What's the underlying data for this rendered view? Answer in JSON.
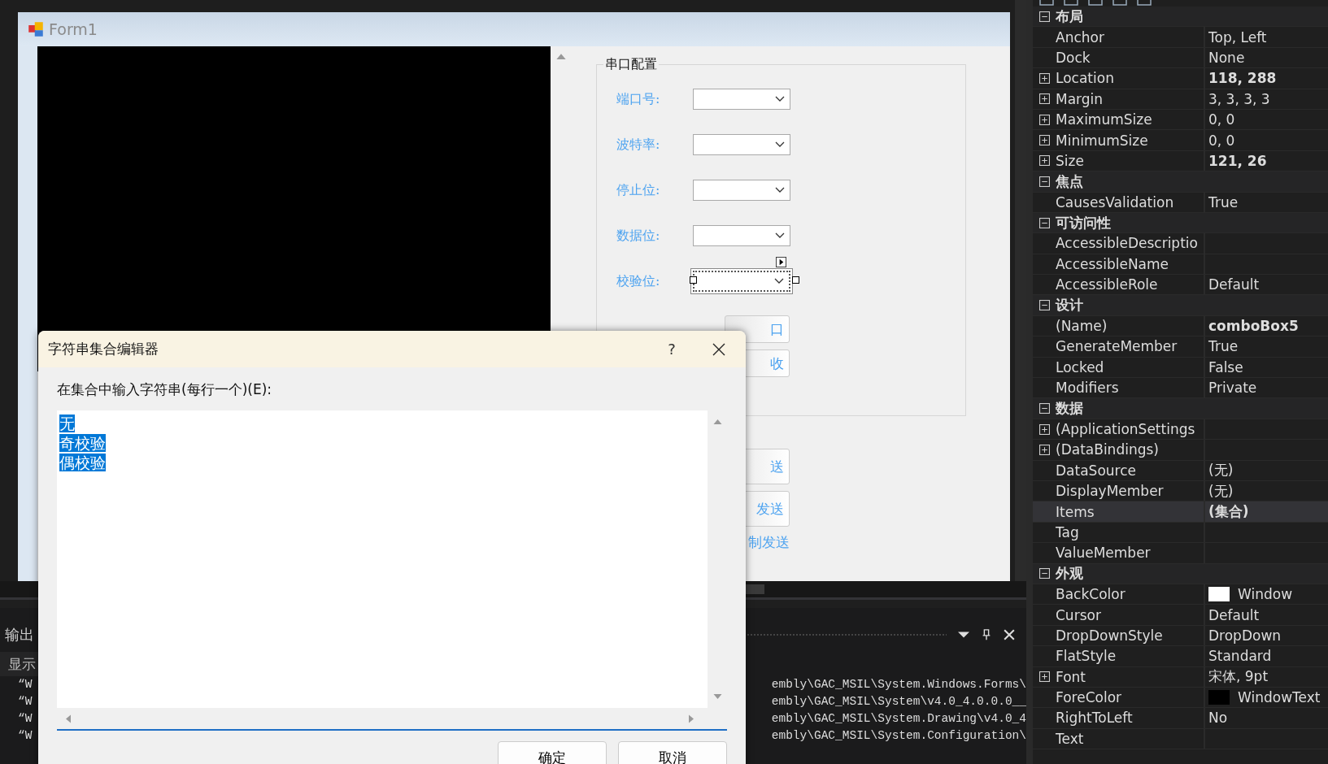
{
  "form": {
    "title": "Form1",
    "group": {
      "title": "串口配置",
      "fields": [
        {
          "label": "端口号:",
          "selected": false
        },
        {
          "label": "波特率:",
          "selected": false
        },
        {
          "label": "停止位:",
          "selected": false
        },
        {
          "label": "数据位:",
          "selected": false
        },
        {
          "label": "校验位:",
          "selected": true
        }
      ]
    },
    "group_buttons": [
      "口",
      "收"
    ],
    "lower_buttons": [
      "送",
      "发送"
    ],
    "lower_label": "制发送"
  },
  "dialog": {
    "title": "字符串集合编辑器",
    "help": "?",
    "prompt": "在集合中输入字符串(每行一个)(E):",
    "lines": [
      "无",
      "奇校验",
      "偶校验"
    ],
    "lines_selected": true,
    "buttons": [
      "确定",
      "取消"
    ]
  },
  "output": {
    "title": "输出",
    "show_label": "显示",
    "lines": [
      {
        "start": "“W",
        "end": "embly\\GAC_MSIL\\System.Windows.Forms\\"
      },
      {
        "start": "“W",
        "end": "embly\\GAC_MSIL\\System\\v4.0_4.0.0.0__"
      },
      {
        "start": "“W",
        "end": "embly\\GAC_MSIL\\System.Drawing\\v4.0_4"
      },
      {
        "start": "“W",
        "end": "embly\\GAC_MSIL\\System.Configuration\\"
      }
    ]
  },
  "properties": {
    "categories": [
      {
        "name": "布局",
        "expanded": true,
        "props": [
          {
            "name": "Anchor",
            "value": "Top, Left",
            "expandable": false,
            "bold": false,
            "selected": false
          },
          {
            "name": "Dock",
            "value": "None",
            "expandable": false,
            "bold": false,
            "selected": false
          },
          {
            "name": "Location",
            "value": "118, 288",
            "expandable": true,
            "bold": true,
            "selected": false
          },
          {
            "name": "Margin",
            "value": "3, 3, 3, 3",
            "expandable": true,
            "bold": false,
            "selected": false
          },
          {
            "name": "MaximumSize",
            "value": "0, 0",
            "expandable": true,
            "bold": false,
            "selected": false
          },
          {
            "name": "MinimumSize",
            "value": "0, 0",
            "expandable": true,
            "bold": false,
            "selected": false
          },
          {
            "name": "Size",
            "value": "121, 26",
            "expandable": true,
            "bold": true,
            "selected": false
          }
        ]
      },
      {
        "name": "焦点",
        "expanded": true,
        "props": [
          {
            "name": "CausesValidation",
            "value": "True",
            "expandable": false,
            "bold": false,
            "selected": false
          }
        ]
      },
      {
        "name": "可访问性",
        "expanded": true,
        "props": [
          {
            "name": "AccessibleDescriptio",
            "expandable": false,
            "selected": false
          },
          {
            "name": "AccessibleName",
            "expandable": false,
            "selected": false
          },
          {
            "name": "AccessibleRole",
            "value": "Default",
            "expandable": false,
            "bold": false,
            "selected": false
          }
        ]
      },
      {
        "name": "设计",
        "expanded": true,
        "props": [
          {
            "name": "(Name)",
            "value": "comboBox5",
            "expandable": false,
            "bold": true,
            "selected": false
          },
          {
            "name": "GenerateMember",
            "value": "True",
            "expandable": false,
            "bold": false,
            "selected": false
          },
          {
            "name": "Locked",
            "value": "False",
            "expandable": false,
            "bold": false,
            "selected": false
          },
          {
            "name": "Modifiers",
            "value": "Private",
            "expandable": false,
            "bold": false,
            "selected": false
          }
        ]
      },
      {
        "name": "数据",
        "expanded": true,
        "props": [
          {
            "name": "(ApplicationSettings",
            "expandable": true,
            "selected": false
          },
          {
            "name": "(DataBindings)",
            "expandable": true,
            "selected": false
          },
          {
            "name": "DataSource",
            "value": "(无)",
            "expandable": false,
            "bold": false,
            "selected": false
          },
          {
            "name": "DisplayMember",
            "value": "(无)",
            "expandable": false,
            "bold": false,
            "selected": false
          },
          {
            "name": "Items",
            "value": "(集合)",
            "expandable": false,
            "bold": true,
            "selected": true
          },
          {
            "name": "Tag",
            "expandable": false,
            "selected": false
          },
          {
            "name": "ValueMember",
            "expandable": false,
            "selected": false
          }
        ]
      },
      {
        "name": "外观",
        "expanded": true,
        "props": [
          {
            "name": "BackColor",
            "value": "Window",
            "color": "#ffffff",
            "expandable": false,
            "bold": false,
            "selected": false
          },
          {
            "name": "Cursor",
            "value": "Default",
            "expandable": false,
            "bold": false,
            "selected": false
          },
          {
            "name": "DropDownStyle",
            "value": "DropDown",
            "expandable": false,
            "bold": false,
            "selected": false
          },
          {
            "name": "FlatStyle",
            "value": "Standard",
            "expandable": false,
            "bold": false,
            "selected": false
          },
          {
            "name": "Font",
            "value": "宋体, 9pt",
            "expandable": true,
            "bold": false,
            "selected": false
          },
          {
            "name": "ForeColor",
            "value": "WindowText",
            "color": "#000000",
            "expandable": false,
            "bold": false,
            "selected": false
          },
          {
            "name": "RightToLeft",
            "value": "No",
            "expandable": false,
            "bold": false,
            "selected": false
          },
          {
            "name": "Text",
            "expandable": false,
            "selected": false
          }
        ]
      }
    ]
  }
}
